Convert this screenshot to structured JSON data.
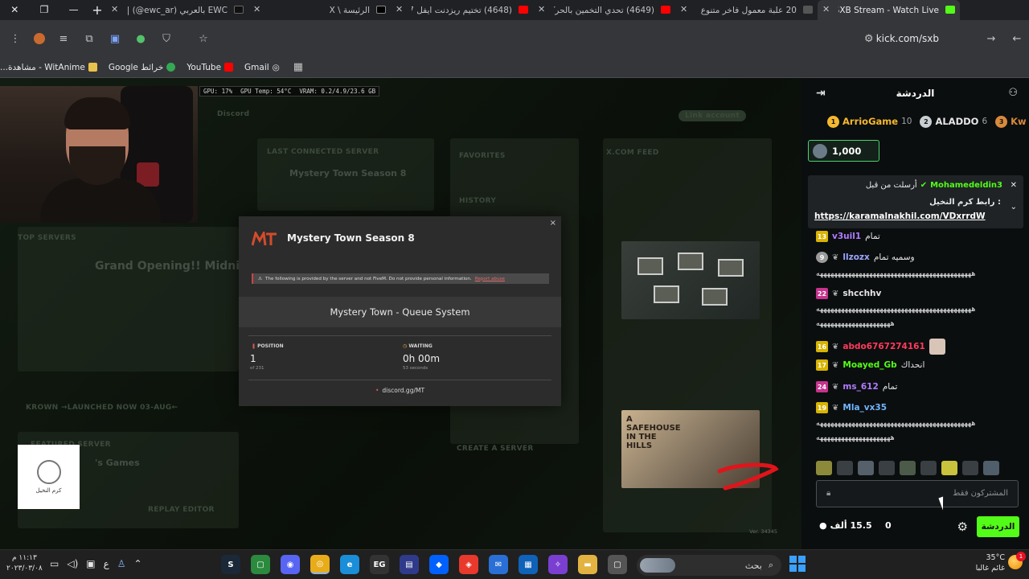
{
  "browser": {
    "tabs": [
      {
        "title": "SXB Stream - Watch Live",
        "active": true,
        "favicon_color": "#53fc18"
      },
      {
        "title": "20 علبة معمول فاخر متنوع",
        "active": false,
        "favicon_color": "#4a4a4a"
      },
      {
        "title": "(4649) تحدي التخمين بالحركا",
        "active": false,
        "favicon_color": "#ff0000"
      },
      {
        "title": "(4648) تختيم ريزدنت ايفل 7",
        "active": false,
        "favicon_color": "#ff0000"
      },
      {
        "title": "الرئيسة \\ X",
        "active": false,
        "favicon_color": "#000000"
      },
      {
        "title": "EWC بالعربي (ewc_ar@) |",
        "active": false,
        "favicon_color": "#111111"
      }
    ],
    "url": "kick.com/sxb",
    "bookmarks": [
      "Gmail",
      "YouTube",
      "خرائط Google",
      "WitAnime - مشاهدة..."
    ]
  },
  "stream": {
    "gpu_overlay": [
      "GPU: 17%",
      "GPU Temp: 54°C",
      "VRAM: 0.2/4.9/23.6 GB"
    ],
    "background_labels": {
      "discord": "Discord",
      "last_connected": "LAST CONNECTED SERVER",
      "last_server": "Mystery Town Season 8",
      "favorites": "FAVORITES",
      "history": "HISTORY",
      "xcom_feed": "X.COM FEED",
      "top_servers": "TOP SERVERS",
      "grand_opening": "Grand Opening!! Midnigh",
      "krown": "KROWN →LAUNCHED NOW 03-AUG←",
      "games": "'s Games",
      "create_server": "CREATE A SERVER",
      "replay_editor": "REPLAY EDITOR",
      "link_account": "Link account",
      "featured": "FEATURED SERVER"
    },
    "logo_caption": "كرم النخيل",
    "poster_text": "A SAFEHOUSE IN THE HILLS",
    "version": "Ver. 34345",
    "modal": {
      "close": "×",
      "title": "Mystery Town Season 8",
      "notice": "The following is provided by the server and not FiveM. Do not provide personal information.",
      "report": "Report abuse",
      "queue_title": "Mystery Town - Queue System",
      "position_label": "POSITION",
      "position_value": "1",
      "position_sub": "of 231",
      "waiting_label": "WAITING",
      "waiting_value": "0h 00m",
      "waiting_sub": "53 seconds",
      "discord": "discord.gg/MT"
    }
  },
  "chat": {
    "title": "الدردشة",
    "gifters": [
      {
        "rank": "1",
        "name": "ArrioGame",
        "count": "10",
        "color": "#f5b82e"
      },
      {
        "rank": "2",
        "name": "ALADDO",
        "count": "6",
        "color": "#c9ced2"
      },
      {
        "rank": "3",
        "name": "Kw",
        "count": "",
        "color": "#d88a3c"
      }
    ],
    "goal": "1,000",
    "pinned": {
      "user": "Mohamedeldin3",
      "meta": "أرسلت من قبل",
      "text": ": رابط كرم النخيل",
      "link": "https://karamalnakhil.com/VDxrrdW"
    },
    "messages": [
      {
        "badge": "13",
        "badge_color": "#d8b400",
        "user": "v3uil1",
        "user_color": "#b07cff",
        "text": "تمام"
      },
      {
        "badge": "9",
        "badge_color": "#9b9b9b",
        "user": "llzozx",
        "user_color": "#9aa6ff",
        "text": "وسميه تمام"
      },
      {
        "badge": "22",
        "badge_color": "#c6338d",
        "user": "shcchhv",
        "user_color": "#e6e6e6",
        "text": ""
      },
      {
        "badge": "16",
        "badge_color": "#d8b400",
        "user": "abdo6767274161",
        "user_color": "#ff3b5c",
        "text": ""
      },
      {
        "badge": "17",
        "badge_color": "#d8b400",
        "user": "Moayed_Gb",
        "user_color": "#53fc18",
        "text": "انحداك"
      },
      {
        "badge": "24",
        "badge_color": "#c6338d",
        "user": "ms_612",
        "user_color": "#b07cff",
        "text": "تمام"
      },
      {
        "badge": "19",
        "badge_color": "#d8b400",
        "user": "Mla_vx35",
        "user_color": "#6fb6ff",
        "text": ""
      }
    ],
    "spam_line": "ههههههههههههههههههههههههههههههههههههههههههههه",
    "spam_short": "هههههههههههههههههههههه",
    "input_placeholder": "المشتركون فقط",
    "send_label": "الدردشة",
    "points": "0",
    "viewers": "15.5 ألف"
  },
  "taskbar": {
    "search_placeholder": "بحث",
    "weather_temp": "35°C",
    "weather_desc": "غائم غالبا",
    "weather_badge": "1",
    "time": "١١:١٣ م",
    "date": "٢٠٢٣/٠٣/٠٨",
    "lang": "ع"
  }
}
